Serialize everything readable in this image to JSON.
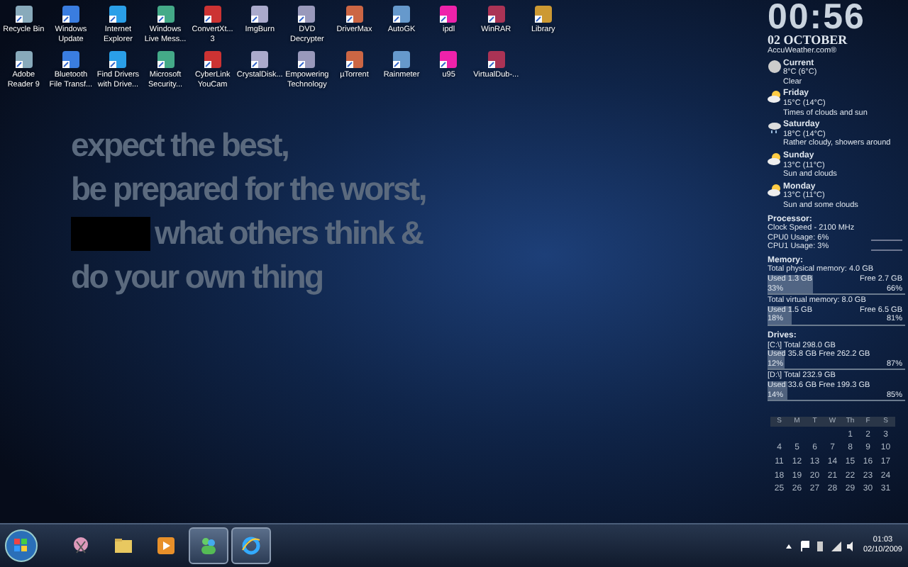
{
  "desktop_icons": [
    {
      "label": "Recycle Bin"
    },
    {
      "label": "Windows Update"
    },
    {
      "label": "Internet Explorer"
    },
    {
      "label": "Windows Live Mess..."
    },
    {
      "label": "ConvertXt... 3"
    },
    {
      "label": "ImgBurn"
    },
    {
      "label": "DVD Decrypter"
    },
    {
      "label": "DriverMax"
    },
    {
      "label": "AutoGK"
    },
    {
      "label": "ipdl"
    },
    {
      "label": "WinRAR"
    },
    {
      "label": "Library"
    },
    {
      "label": "Adobe Reader 9"
    },
    {
      "label": "Bluetooth File Transf..."
    },
    {
      "label": "Find Drivers with Drive..."
    },
    {
      "label": "Microsoft Security..."
    },
    {
      "label": "CyberLink YouCam"
    },
    {
      "label": "CrystalDisk..."
    },
    {
      "label": "Empowering Technology"
    },
    {
      "label": "µTorrent"
    },
    {
      "label": "Rainmeter"
    },
    {
      "label": "u95"
    },
    {
      "label": "VirtualDub-..."
    }
  ],
  "wallpaper_quote": [
    {
      "kind": "text",
      "text": "expect the best,"
    },
    {
      "kind": "text",
      "text": "be prepared for the worst,"
    },
    {
      "kind": "redacted",
      "text": "what others think &"
    },
    {
      "kind": "text",
      "text": "do your own thing"
    }
  ],
  "clock_widget": {
    "time": "00:56",
    "date": "02 OCTOBER"
  },
  "weather": {
    "source": "AccuWeather.com®",
    "days": [
      {
        "day": "Current",
        "temp": "8°C (6°C)",
        "desc": "Clear",
        "kind": "moon"
      },
      {
        "day": "Friday",
        "temp": "15°C (14°C)",
        "desc": "Times of clouds and sun",
        "kind": "cloud"
      },
      {
        "day": "Saturday",
        "temp": "18°C (14°C)",
        "desc": "Rather cloudy, showers around",
        "kind": "rain"
      },
      {
        "day": "Sunday",
        "temp": "13°C (11°C)",
        "desc": "Sun and clouds",
        "kind": "cloud"
      },
      {
        "day": "Monday",
        "temp": "13°C (11°C)",
        "desc": "Sun and some clouds",
        "kind": "cloud"
      }
    ]
  },
  "processor": {
    "title": "Processor:",
    "speed": "Clock Speed - 2100 MHz",
    "cpus": [
      "CPU0 Usage: 6%",
      "CPU1 Usage: 3%"
    ]
  },
  "memory": {
    "title": "Memory:",
    "items": [
      {
        "total": "Total physical memory: 4.0 GB",
        "used": "Used 1.3 GB",
        "free": "Free 2.7 GB",
        "used_pct": "33%",
        "free_pct": "66%",
        "level": 0.33
      },
      {
        "total": "Total virtual memory: 8.0 GB",
        "used": "Used 1.5 GB",
        "free": "Free 6.5 GB",
        "used_pct": "18%",
        "free_pct": "81%",
        "level": 0.18
      }
    ]
  },
  "drives": {
    "title": "Drives:",
    "items": [
      {
        "total": "[C:\\] Total 298.0 GB",
        "usage": "Used 35.8 GB Free 262.2 GB",
        "used_pct": "12%",
        "free_pct": "87%",
        "level": 0.12
      },
      {
        "total": "[D:\\] Total 232.9 GB",
        "usage": "Used 33.6 GB Free 199.3 GB",
        "used_pct": "14%",
        "free_pct": "85%",
        "level": 0.14
      }
    ]
  },
  "calendar": {
    "weekdays": [
      "S",
      "M",
      "T",
      "W",
      "Th",
      "F",
      "S"
    ],
    "weeks": [
      [
        "1",
        "2",
        "3"
      ],
      [
        "4",
        "5",
        "6",
        "7",
        "8",
        "9",
        "10"
      ],
      [
        "11",
        "12",
        "13",
        "14",
        "15",
        "16",
        "17"
      ],
      [
        "18",
        "19",
        "20",
        "21",
        "22",
        "23",
        "24"
      ],
      [
        "25",
        "26",
        "27",
        "28",
        "29",
        "30",
        "31"
      ]
    ]
  },
  "taskbar": {
    "apps": [
      {
        "kind": "snip",
        "running": false
      },
      {
        "kind": "folder",
        "running": false
      },
      {
        "kind": "media",
        "running": false
      },
      {
        "kind": "messenger",
        "running": true
      },
      {
        "kind": "browser",
        "running": true
      }
    ],
    "tray": {
      "time": "01:03",
      "date": "02/10/2009"
    }
  }
}
